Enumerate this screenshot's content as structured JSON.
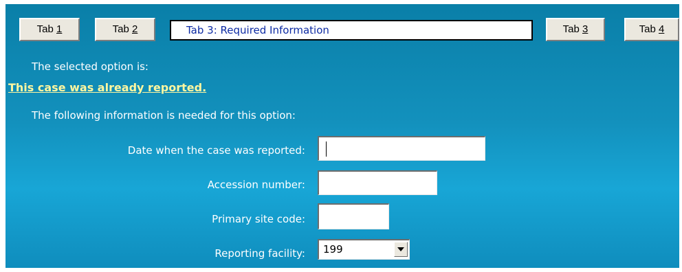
{
  "tabs": [
    {
      "label_prefix": "Tab ",
      "label_key": "1"
    },
    {
      "label_prefix": "Tab ",
      "label_key": "2"
    },
    {
      "label_prefix": "Tab ",
      "label_key": "3"
    },
    {
      "label_prefix": "Tab ",
      "label_key": "4"
    }
  ],
  "title": "Tab 3: Required Information",
  "selected_label": "The selected option is:",
  "selected_option": "This case was already reported.",
  "info_needed": "The following information is needed for this option:",
  "fields": {
    "date_reported": {
      "label": "Date when the case was reported:",
      "value": ""
    },
    "accession_number": {
      "label": "Accession number:",
      "value": ""
    },
    "primary_site_code": {
      "label": "Primary site code:",
      "value": ""
    },
    "reporting_facility": {
      "label": "Reporting facility:",
      "value": "199"
    }
  },
  "colors": {
    "panel": "#1391bd",
    "highlight_text": "#fff7a0",
    "title_text": "#0c2aa3"
  },
  "icons": {
    "dropdown": "chevron-down-icon"
  }
}
